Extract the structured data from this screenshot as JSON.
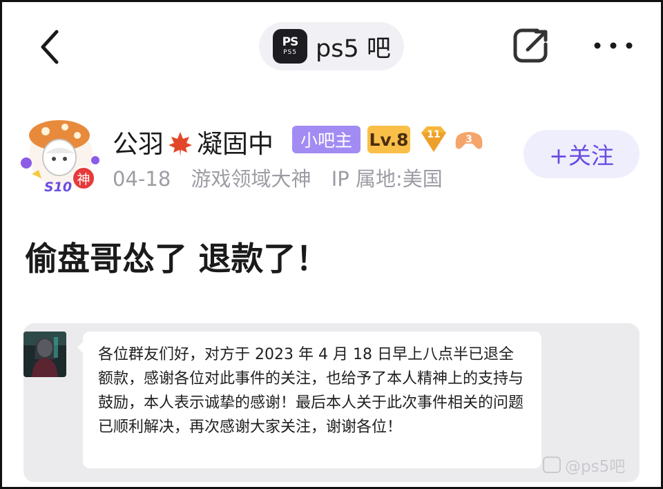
{
  "topbar": {
    "back_icon": "chevron-left-icon",
    "forum": {
      "logo_mark": "PS",
      "logo_sub": "PS5",
      "name": "ps5 吧"
    },
    "share_icon": "share-icon",
    "more_icon": "more-icon"
  },
  "author": {
    "avatar_badge": "神",
    "avatar_tag": "S10",
    "name_part1": "公羽",
    "name_part2": "凝固中",
    "role_badge": "小吧主",
    "level_badge": "Lv.8",
    "gem_badge": "11",
    "game_badge": "3",
    "date": "04-18",
    "title": "游戏领域大神",
    "ip_location": "IP 属地:美国",
    "follow_label": "+关注"
  },
  "post": {
    "title": "偷盘哥怂了 退款了！"
  },
  "chat_image": {
    "message": "各位群友们好，对方于 2023 年 4 月 18 日早上八点半已退全额款，感谢各位对此事件的关注，也给予了本人精神上的支持与鼓励，本人表示诚挚的感谢！最后本人关于此次事件相关的问题已顺利解决，再次感谢大家关注，谢谢各位！",
    "watermark": "@ps5吧"
  },
  "colors": {
    "accent": "#6a4de0",
    "role_badge": "#a28cf4",
    "level_badge": "#f9bf48",
    "pill_bg": "#f1f1f5",
    "card_bg": "#ebebed"
  }
}
